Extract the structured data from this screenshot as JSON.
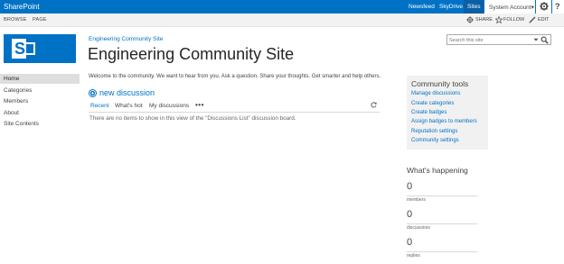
{
  "suitebar": {
    "brand": "SharePoint",
    "links": [
      "Newsfeed",
      "SkyDrive",
      "Sites"
    ],
    "account": "System Account",
    "account_caret": "▾",
    "help": "?",
    "colors": {
      "bar": "#0072c6"
    }
  },
  "ribbon": {
    "tabs": [
      "BROWSE",
      "PAGE"
    ],
    "actions": {
      "share": "SHARE",
      "follow": "FOLLOW",
      "edit": "EDIT"
    }
  },
  "site": {
    "logo_letter": "S",
    "breadcrumb": "Engineering Community Site",
    "title": "Engineering Community Site"
  },
  "search": {
    "placeholder": "Search this site"
  },
  "leftnav": {
    "items": [
      "Home",
      "Categories",
      "Members",
      "About",
      "Site Contents"
    ],
    "selected": "Home"
  },
  "main": {
    "welcome": "Welcome to the community. We want to hear from you. Ask a question. Share your thoughts. Get smarter and help others.",
    "new_discussion": "new discussion",
    "views": [
      "Recent",
      "What's hot",
      "My discussions"
    ],
    "more": "•••",
    "empty_message": "There are no items to show in this view of the \"Discussions List\" discussion board."
  },
  "community_tools": {
    "title": "Community tools",
    "links": [
      "Manage discussions",
      "Create categories",
      "Create badges",
      "Assign badges to members",
      "Reputation settings",
      "Community settings"
    ]
  },
  "happening": {
    "title": "What's happening",
    "stats": [
      {
        "value": "0",
        "label": "members"
      },
      {
        "value": "0",
        "label": "discussions"
      },
      {
        "value": "0",
        "label": "replies"
      }
    ]
  },
  "icons": [
    "gear-icon",
    "help-icon",
    "share-icon",
    "follow-icon",
    "edit-icon",
    "search-icon",
    "plus-icon",
    "refresh-icon"
  ]
}
